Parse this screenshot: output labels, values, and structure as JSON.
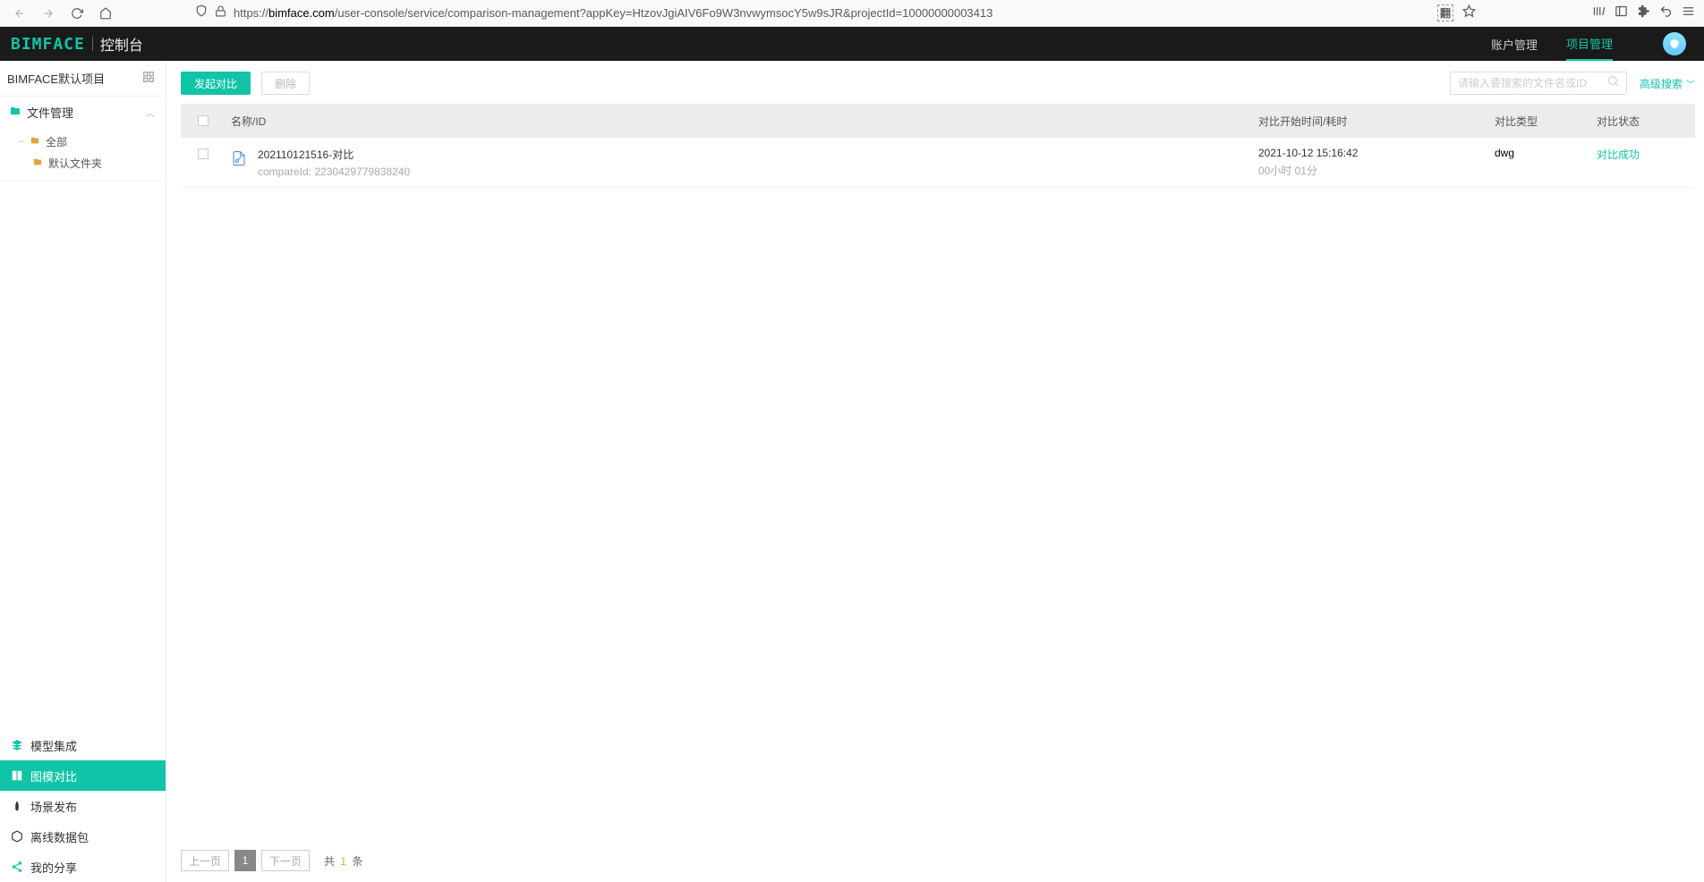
{
  "browser": {
    "url_domain": "bimface.com",
    "url_path": "/user-console/service/comparison-management?appKey=HtzovJgiAIV6Fo9W3nvwymsocY5w9sJR&projectId=10000000003413",
    "url_scheme": "https://"
  },
  "header": {
    "logo_mark": "BIMFACE",
    "logo_text": "控制台",
    "links": {
      "account": "账户管理",
      "project": "项目管理"
    }
  },
  "sidebar": {
    "project_name": "BIMFACE默认项目",
    "file_mgmt": "文件管理",
    "tree": {
      "all": "全部",
      "default_folder": "默认文件夹"
    },
    "items": {
      "model_integration": "模型集成",
      "diagram_compare": "图模对比",
      "scene_publish": "场景发布",
      "offline_package": "离线数据包",
      "my_share": "我的分享"
    }
  },
  "toolbar": {
    "start_compare": "发起对比",
    "delete": "删除",
    "search_placeholder": "请输入要搜索的文件名或ID",
    "adv_search": "高级搜索"
  },
  "table": {
    "headers": {
      "name": "名称/ID",
      "time": "对比开始时间/耗时",
      "type": "对比类型",
      "status": "对比状态"
    },
    "rows": [
      {
        "name": "202110121516-对比",
        "id_label": "compareId:",
        "id_value": "2230429779838240",
        "time": "2021-10-12 15:16:42",
        "duration": "00小时 01分",
        "type": "dwg",
        "status": "对比成功"
      }
    ]
  },
  "pagination": {
    "prev": "上一页",
    "current": "1",
    "next": "下一页",
    "total_prefix": "共",
    "total_count": "1",
    "total_suffix": "条"
  }
}
